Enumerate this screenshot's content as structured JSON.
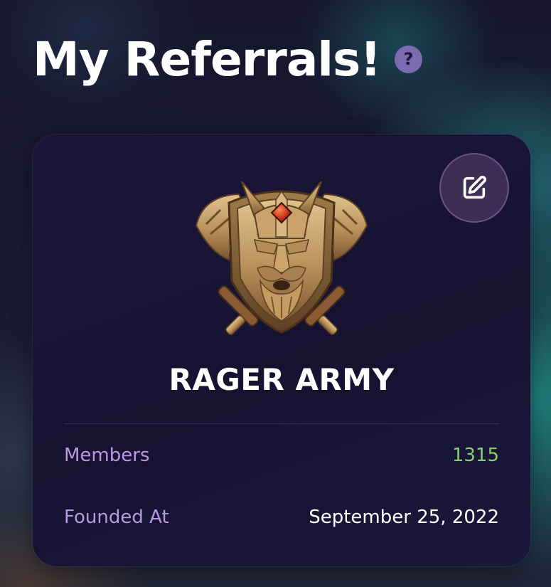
{
  "page": {
    "title": "My Referrals!",
    "help_icon": "question-mark-icon",
    "help_glyph": "?"
  },
  "card": {
    "edit_icon": "edit-icon",
    "emblem_icon": "dwarf-warrior-emblem-icon",
    "clan_name": "RAGER ARMY",
    "stats": [
      {
        "label": "Members",
        "value": "1315",
        "value_color": "#82d36a"
      },
      {
        "label": "Founded At",
        "value": "September 25, 2022",
        "value_color": "#ffffff"
      }
    ]
  }
}
